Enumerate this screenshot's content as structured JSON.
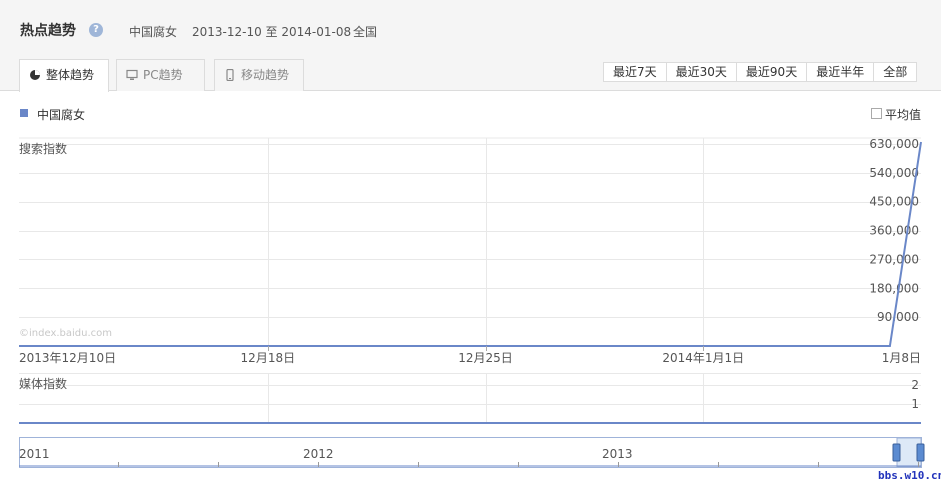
{
  "header": {
    "title": "热点趋势",
    "help": "?",
    "keyword": "中国腐女",
    "date_range": "2013-12-10 至 2014-01-08",
    "region": "全国"
  },
  "tabs": [
    {
      "label": "整体趋势",
      "icon": "pie-icon",
      "active": true
    },
    {
      "label": "PC趋势",
      "icon": "monitor-icon",
      "active": false
    },
    {
      "label": "移动趋势",
      "icon": "mobile-icon",
      "active": false
    }
  ],
  "ranges": [
    "最近7天",
    "最近30天",
    "最近90天",
    "最近半年",
    "全部"
  ],
  "legend": {
    "series_name": "中国腐女",
    "avg_label": "平均值"
  },
  "colors": {
    "line": "#6a87c8",
    "grid": "#e8e8e8",
    "navigator_fill": "#dde9f7"
  },
  "chart_data": [
    {
      "type": "line",
      "ylabel": "搜索指数",
      "watermark": "©index.baidu.com",
      "ylim": [
        0,
        630000
      ],
      "yticks": [
        "630,000",
        "540,000",
        "450,000",
        "360,000",
        "270,000",
        "180,000",
        "90,000"
      ],
      "ytick_values": [
        630000,
        540000,
        450000,
        360000,
        270000,
        180000,
        90000
      ],
      "xticks": [
        "2013年12月10日",
        "12月18日",
        "12月25日",
        "2014年1月1日",
        "1月8日"
      ],
      "x": [
        "2013-12-10",
        "2013-12-11",
        "2013-12-12",
        "2013-12-13",
        "2013-12-14",
        "2013-12-15",
        "2013-12-16",
        "2013-12-17",
        "2013-12-18",
        "2013-12-19",
        "2013-12-20",
        "2013-12-21",
        "2013-12-22",
        "2013-12-23",
        "2013-12-24",
        "2013-12-25",
        "2013-12-26",
        "2013-12-27",
        "2013-12-28",
        "2013-12-29",
        "2013-12-30",
        "2013-12-31",
        "2014-01-01",
        "2014-01-02",
        "2014-01-03",
        "2014-01-04",
        "2014-01-05",
        "2014-01-06",
        "2014-01-07",
        "2014-01-08"
      ],
      "series": [
        {
          "name": "中国腐女",
          "values": [
            0,
            0,
            0,
            0,
            0,
            0,
            0,
            0,
            0,
            0,
            0,
            0,
            0,
            0,
            0,
            0,
            0,
            0,
            0,
            0,
            0,
            0,
            0,
            0,
            0,
            0,
            0,
            0,
            0,
            640000
          ]
        }
      ]
    },
    {
      "type": "line",
      "ylabel": "媒体指数",
      "yticks": [
        "2",
        "1"
      ],
      "ytick_values": [
        2,
        1
      ],
      "ylim": [
        0,
        2
      ],
      "series": [
        {
          "name": "中国腐女",
          "values": [
            0,
            0,
            0,
            0,
            0,
            0,
            0,
            0,
            0,
            0,
            0,
            0,
            0,
            0,
            0,
            0,
            0,
            0,
            0,
            0,
            0,
            0,
            0,
            0,
            0,
            0,
            0,
            0,
            0,
            0
          ]
        }
      ]
    }
  ],
  "navigator": {
    "years": [
      "2011",
      "2012",
      "2013"
    ]
  },
  "watermark": "bbs.w10.cn"
}
